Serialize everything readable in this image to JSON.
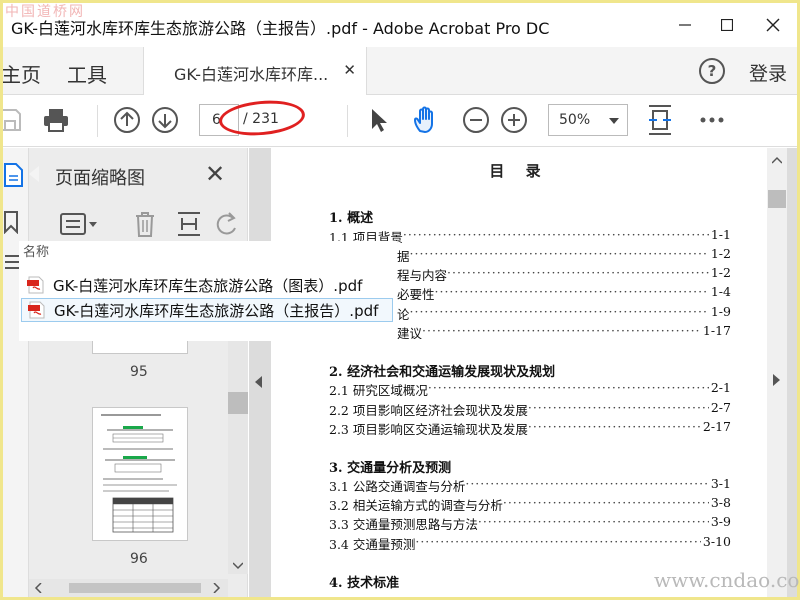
{
  "window": {
    "title": "GK-白莲河水库环库生态旅游公路（主报告）.pdf - Adobe Acrobat Pro DC",
    "watermark_top": "中国道桥网",
    "watermark_bottom": "www.cndao.com"
  },
  "menu": {
    "home": "主页",
    "tools": "工具",
    "doc_tab": "GK-白莲河水库环库...",
    "login": "登录",
    "help_glyph": "?"
  },
  "toolbar": {
    "page_current": "6",
    "page_total": "/ 231",
    "zoom": "50%"
  },
  "thumbnails": {
    "title": "页面缩略图",
    "pages": [
      {
        "number": "95"
      },
      {
        "number": "96"
      }
    ]
  },
  "file_overlay": {
    "header": "名称",
    "files": [
      {
        "name": "GK-白莲河水库环库生态旅游公路（图表）.pdf",
        "selected": false
      },
      {
        "name": "GK-白莲河水库环库生态旅游公路（主报告）.pdf",
        "selected": true
      }
    ]
  },
  "document": {
    "toc_title": "目 录",
    "sections": [
      {
        "heading": "1.  概述",
        "items": [
          {
            "label": "1.1  项目背景",
            "page": "1-1"
          },
          {
            "label": "据",
            "page": "1-2"
          },
          {
            "label": "程与内容",
            "page": "1-2"
          },
          {
            "label": "必要性",
            "page": "1-4"
          },
          {
            "label": "论",
            "page": "1-9"
          },
          {
            "label": "建议",
            "page": "1-17"
          }
        ]
      },
      {
        "heading": "2.  经济社会和交通运输发展现状及规划",
        "items": [
          {
            "label": "2.1  研究区域概况",
            "page": "2-1"
          },
          {
            "label": "2.2  项目影响区经济社会现状及发展",
            "page": "2-7"
          },
          {
            "label": "2.3  项目影响区交通运输现状及发展",
            "page": "2-17"
          }
        ]
      },
      {
        "heading": "3.  交通量分析及预测",
        "items": [
          {
            "label": "3.1  公路交通调查与分析",
            "page": "3-1"
          },
          {
            "label": "3.2  相关运输方式的调查与分析",
            "page": "3-8"
          },
          {
            "label": "3.3  交通量预测思路与方法",
            "page": "3-9"
          },
          {
            "label": "3.4  交通量预测",
            "page": "3-10"
          }
        ]
      },
      {
        "heading": "4.  技术标准",
        "items": []
      }
    ]
  },
  "colors": {
    "accent_blue": "#1473e6",
    "annotation_red": "#e02020",
    "pdf_red": "#d9261c",
    "frame_yellow": "#f0e68c"
  }
}
